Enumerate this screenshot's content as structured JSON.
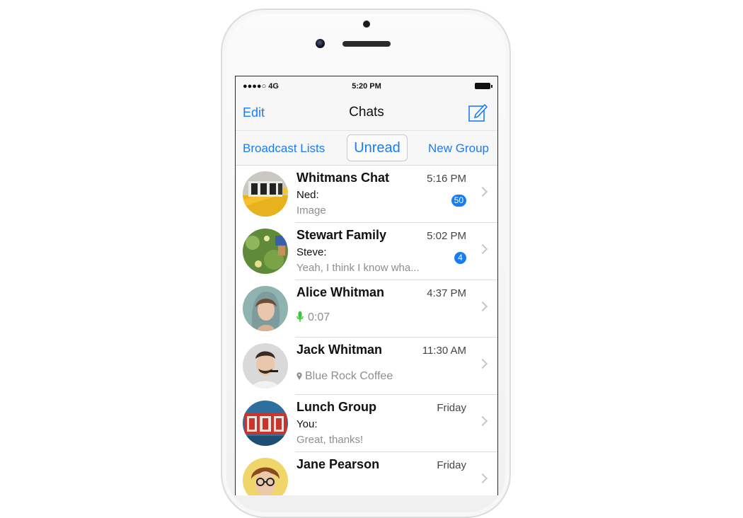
{
  "status_bar": {
    "signal": "●●●●○ 4G",
    "time": "5:20 PM"
  },
  "nav": {
    "edit_label": "Edit",
    "title": "Chats",
    "compose_icon": "compose-icon"
  },
  "segments": {
    "broadcast": "Broadcast Lists",
    "unread": "Unread",
    "new_group": "New Group"
  },
  "accent_color": "#1a7cf5",
  "chats": [
    {
      "name": "Whitmans Chat",
      "time": "5:16 PM",
      "sender": "Ned:",
      "preview": "Image",
      "badge": "50"
    },
    {
      "name": "Stewart Family",
      "time": "5:02 PM",
      "sender": "Steve:",
      "preview": "Yeah, I think I know wha...",
      "badge": "4"
    },
    {
      "name": "Alice Whitman",
      "time": "4:37 PM",
      "preview": "0:07",
      "preview_icon": "microphone-icon"
    },
    {
      "name": "Jack Whitman",
      "time": "11:30 AM",
      "preview": "Blue Rock Coffee",
      "preview_icon": "location-pin-icon"
    },
    {
      "name": "Lunch Group",
      "time": "Friday",
      "sender": "You:",
      "preview": "Great, thanks!"
    },
    {
      "name": "Jane Pearson",
      "time": "Friday",
      "preview": ""
    }
  ]
}
